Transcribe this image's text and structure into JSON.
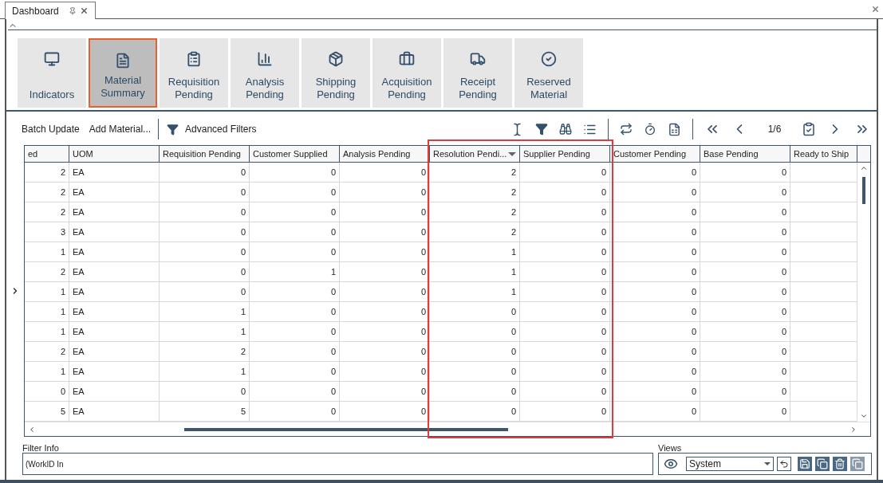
{
  "tab": {
    "label": "Dashboard"
  },
  "tiles": [
    {
      "label": "Indicators",
      "selected": false,
      "kind": "monitor"
    },
    {
      "label": "Material Summary",
      "selected": true,
      "kind": "document"
    },
    {
      "label": "Requisition Pending",
      "selected": false,
      "kind": "list"
    },
    {
      "label": "Analysis Pending",
      "selected": false,
      "kind": "chart"
    },
    {
      "label": "Shipping Pending",
      "selected": false,
      "kind": "package"
    },
    {
      "label": "Acquisition Pending",
      "selected": false,
      "kind": "briefcase"
    },
    {
      "label": "Receipt Pending",
      "selected": false,
      "kind": "truck"
    },
    {
      "label": "Reserved Material",
      "selected": false,
      "kind": "check"
    }
  ],
  "toolbar": {
    "actions": [
      "Batch Update",
      "Add Material..."
    ],
    "advanced_filters": "Advanced Filters",
    "page": "1/6"
  },
  "table": {
    "columns": [
      {
        "label": "ed",
        "sorted": false
      },
      {
        "label": "UOM",
        "sorted": false
      },
      {
        "label": "Requisition Pending",
        "sorted": false
      },
      {
        "label": "Customer Supplied",
        "sorted": false
      },
      {
        "label": "Analysis Pending",
        "sorted": false
      },
      {
        "label": "Resolution Pendi...",
        "sorted": true
      },
      {
        "label": "Supplier Pending",
        "sorted": false
      },
      {
        "label": "Customer Pending",
        "sorted": false
      },
      {
        "label": "Base Pending",
        "sorted": false
      },
      {
        "label": "Ready to Ship",
        "sorted": false
      }
    ],
    "rows": [
      [
        "2",
        "EA",
        "0",
        "0",
        "0",
        "2",
        "0",
        "0",
        "0"
      ],
      [
        "2",
        "EA",
        "0",
        "0",
        "0",
        "2",
        "0",
        "0",
        "0"
      ],
      [
        "2",
        "EA",
        "0",
        "0",
        "0",
        "2",
        "0",
        "0",
        "0"
      ],
      [
        "3",
        "EA",
        "0",
        "0",
        "0",
        "2",
        "0",
        "0",
        "0"
      ],
      [
        "1",
        "EA",
        "0",
        "0",
        "0",
        "1",
        "0",
        "0",
        "0"
      ],
      [
        "2",
        "EA",
        "0",
        "1",
        "0",
        "1",
        "0",
        "0",
        "0"
      ],
      [
        "1",
        "EA",
        "0",
        "0",
        "0",
        "1",
        "0",
        "0",
        "0"
      ],
      [
        "1",
        "EA",
        "1",
        "0",
        "0",
        "0",
        "0",
        "0",
        "0"
      ],
      [
        "1",
        "EA",
        "1",
        "0",
        "0",
        "0",
        "0",
        "0",
        "0"
      ],
      [
        "2",
        "EA",
        "2",
        "0",
        "0",
        "0",
        "0",
        "0",
        "0"
      ],
      [
        "1",
        "EA",
        "1",
        "0",
        "0",
        "0",
        "0",
        "0",
        "0"
      ],
      [
        "0",
        "EA",
        "0",
        "0",
        "0",
        "0",
        "0",
        "0",
        "0"
      ],
      [
        "5",
        "EA",
        "5",
        "0",
        "0",
        "0",
        "0",
        "0",
        "0"
      ]
    ]
  },
  "filter_info": {
    "label": "Filter Info",
    "value": "(WorkID In"
  },
  "views": {
    "label": "Views",
    "value": "System"
  }
}
